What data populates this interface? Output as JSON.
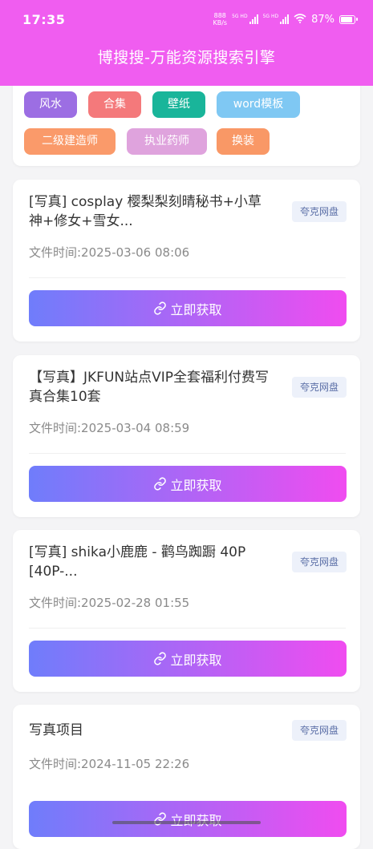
{
  "status_bar": {
    "time": "17:35",
    "net_speed_value": "888",
    "net_speed_unit": "KB/s",
    "sim1_label": "5G HD",
    "sim2_label": "5G HD",
    "battery_percent": "87%"
  },
  "app": {
    "title": "博搜搜-万能资源搜索引擎",
    "header_color": "#f05df0"
  },
  "tags": [
    {
      "label": "风水",
      "color": "#9c6ee3"
    },
    {
      "label": "合集",
      "color": "#f4797b"
    },
    {
      "label": "壁纸",
      "color": "#19b59a"
    },
    {
      "label": "word模板",
      "color": "#7fc8f3"
    },
    {
      "label": "二级建造师",
      "color": "#fa9a6a"
    },
    {
      "label": "执业药师",
      "color": "#dfa3dd"
    },
    {
      "label": "换装",
      "color": "#f99866"
    }
  ],
  "results": [
    {
      "title": "[写真] cosplay 樱梨梨刻晴秘书+小草神+修女+雪女...",
      "badge": "夸克网盘",
      "time": "文件时间:2025-03-06 08:06",
      "button": "立即获取"
    },
    {
      "title": "【写真】JKFUN站点VIP全套福利付费写真合集10套",
      "badge": "夸克网盘",
      "time": "文件时间:2025-03-04 08:59",
      "button": "立即获取"
    },
    {
      "title": "[写真] shika小鹿鹿 - 鹳鸟踟蹰 40P [40P-...",
      "badge": "夸克网盘",
      "time": "文件时间:2025-02-28 01:55",
      "button": "立即获取"
    },
    {
      "title": "写真项目",
      "badge": "夸克网盘",
      "time": "文件时间:2024-11-05 22:26",
      "button": "立即获取"
    }
  ],
  "icons": {
    "link": "link-icon",
    "wifi": "wifi-icon",
    "battery": "battery-icon"
  },
  "colors": {
    "button_start": "#6f7dfb",
    "button_end": "#f04cf0",
    "badge_bg": "#edf1fa",
    "badge_text": "#5b6fa7"
  }
}
